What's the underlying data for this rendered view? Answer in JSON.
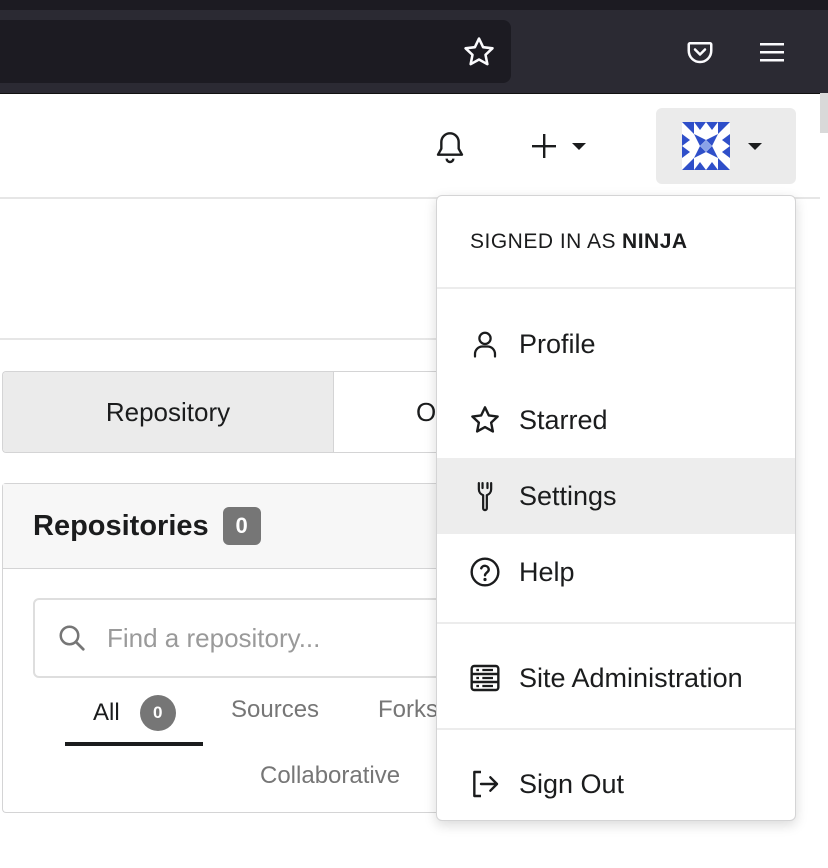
{
  "browser": {
    "bookmark_icon": "star-outline-icon",
    "pocket_icon": "pocket-icon",
    "menu_icon": "hamburger-icon"
  },
  "navbar": {
    "notifications_icon": "bell-icon",
    "create_icon": "plus-icon",
    "user_avatar": "identicon-avatar"
  },
  "tabs": {
    "repository_label": "Repository",
    "other_label": "O"
  },
  "repos": {
    "title": "Repositories",
    "count": "0",
    "search_placeholder": "Find a repository...",
    "filters": {
      "all_label": "All",
      "all_count": "0",
      "sources_label": "Sources",
      "forks_label": "Forks",
      "collaborative_label": "Collaborative"
    }
  },
  "user_menu": {
    "header_prefix": "SIGNED IN AS",
    "username": "NINJA",
    "items": [
      {
        "label": "Profile",
        "icon": "person-icon"
      },
      {
        "label": "Starred",
        "icon": "star-icon"
      },
      {
        "label": "Settings",
        "icon": "wrench-icon",
        "active": true
      },
      {
        "label": "Help",
        "icon": "question-circle-icon"
      },
      {
        "label": "Site Administration",
        "icon": "server-icon"
      },
      {
        "label": "Sign Out",
        "icon": "sign-out-icon"
      }
    ]
  },
  "colors": {
    "browser_bg": "#2b2a33",
    "active_item_bg": "#ededed",
    "badge_bg": "#767676",
    "avatar_blue": "#2f4fc9"
  }
}
